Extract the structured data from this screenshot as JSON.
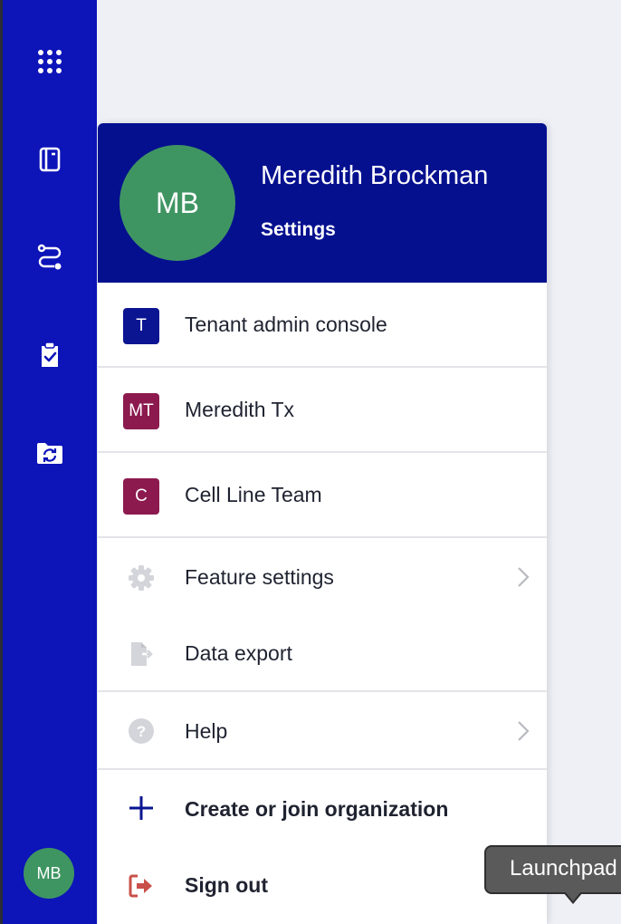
{
  "sidebar": {
    "icons": [
      "grid-icon",
      "notebook-icon",
      "workflow-icon",
      "clipboard-check-icon",
      "folder-sync-icon"
    ],
    "avatar_initials": "MB",
    "accent_color": "#0d14b8"
  },
  "profile": {
    "initials": "MB",
    "name": "Meredith Brockman",
    "settings_label": "Settings",
    "avatar_color": "#3f9562",
    "header_color": "#05108f"
  },
  "organizations": [
    {
      "badge": "T",
      "label": "Tenant admin console",
      "badge_color": "#0b1592"
    },
    {
      "badge": "MT",
      "label": "Meredith Tx",
      "badge_color": "#8c1a4f"
    },
    {
      "badge": "C",
      "label": "Cell Line Team",
      "badge_color": "#8c1a4f"
    }
  ],
  "menu": {
    "feature_settings": "Feature settings",
    "data_export": "Data export",
    "help": "Help",
    "create_org": "Create or join organization",
    "sign_out": "Sign out"
  },
  "tooltip": {
    "text": "Launchpad"
  }
}
